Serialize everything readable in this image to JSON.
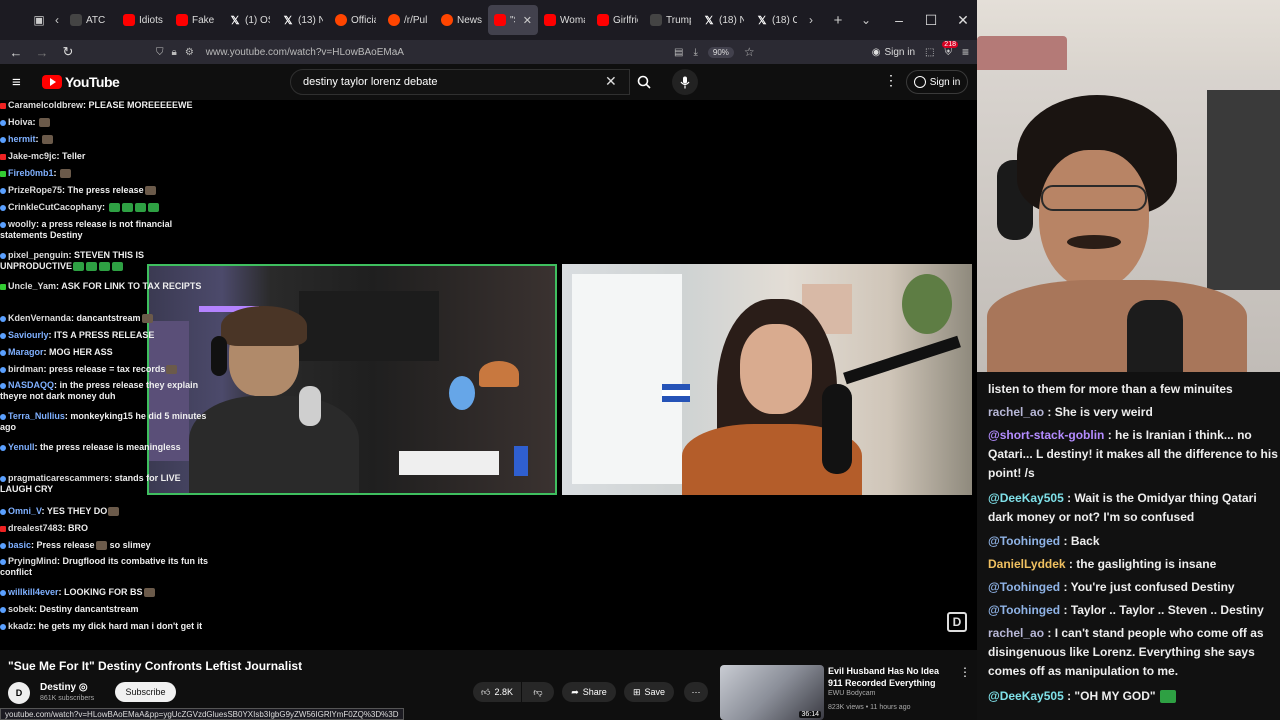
{
  "browser": {
    "tabs": [
      {
        "label": "ATC",
        "icon": "blank"
      },
      {
        "label": "Idiots",
        "icon": "yt"
      },
      {
        "label": "Fake L",
        "icon": "yt"
      },
      {
        "label": "(1) OS",
        "icon": "x"
      },
      {
        "label": "(13) N",
        "icon": "x"
      },
      {
        "label": "Officia",
        "icon": "rd"
      },
      {
        "label": "/r/Pul",
        "icon": "rd"
      },
      {
        "label": "News",
        "icon": "rd"
      },
      {
        "label": "\"Su",
        "icon": "yt",
        "active": true
      },
      {
        "label": "Woma",
        "icon": "yt"
      },
      {
        "label": "Girlfrie",
        "icon": "yt"
      },
      {
        "label": "Trump",
        "icon": "blank"
      },
      {
        "label": "(18) N",
        "icon": "x"
      },
      {
        "label": "(18) O",
        "icon": "x"
      }
    ],
    "url": "www.youtube.com/watch?v=HLowBAoEMaA",
    "zoom": "90%",
    "sign_in": "Sign in",
    "ext_count": "218",
    "status_url": "youtube.com/watch?v=HLowBAoEMaA&pp=ygUcZGVzdGluesSB0YXIsb3IgbG9yZW56IGRlYmF0ZQ%3D%3D"
  },
  "youtube": {
    "logo_text": "YouTube",
    "search_query": "destiny taylor lorenz debate",
    "sign_in": "Sign in",
    "video_title": "\"Sue Me For It\" Destiny Confronts Leftist Journalist",
    "channel_name": "Destiny ◎",
    "channel_subs": "861K subscribers",
    "subscribe": "Subscribe",
    "likes": "2.8K",
    "share": "Share",
    "save": "Save",
    "recommendation": {
      "title": "Evil Husband Has No Idea 911 Recorded Everything",
      "channel": "EWU Bodycam",
      "meta": "823K views • 11 hours ago",
      "duration": "36:14"
    }
  },
  "overlay_chat": [
    {
      "name": "Caramelcoldbrew",
      "text": "PLEASE MOREEEEEWE",
      "icon": "red"
    },
    {
      "name": "Hoiva",
      "text": "",
      "emote": true
    },
    {
      "name": "hermit",
      "text": "",
      "emote": true,
      "nameColor": "#7fb0ff"
    },
    {
      "name": "Jake-mc9jc",
      "text": "Teller",
      "icon": "red"
    },
    {
      "name": "Fireb0mb1",
      "text": "",
      "emote": true,
      "nameColor": "#7fb0ff",
      "icon": "green"
    },
    {
      "name": "PrizeRope75",
      "text": "The press release",
      "emote": true
    },
    {
      "name": "CrinkleCutCacophany",
      "text": "",
      "emote": "green"
    },
    {
      "name": "woolly",
      "text": "a press release is not financial statements Destiny"
    },
    {
      "name": "pixel_penguin",
      "text": "STEVEN THIS IS UNPRODUCTIVE",
      "emote": "green"
    },
    {
      "name": "Uncle_Yam",
      "text": "ASK FOR LINK TO TAX RECIPTS",
      "icon": "green"
    },
    {
      "name": "KdenVernanda",
      "text": "dancantstream",
      "emote": true
    },
    {
      "name": "Saviourly",
      "text": "ITS A PRESS RELEASE",
      "nameColor": "#7fb0ff"
    },
    {
      "name": "Maragor",
      "text": "MOG HER ASS",
      "nameColor": "#7fb0ff"
    },
    {
      "name": "birdman",
      "text": "press release = tax records",
      "emote": true
    },
    {
      "name": "NASDAQQ",
      "text": "in the press release they explain theyre not dark money duh",
      "nameColor": "#7fb0ff"
    },
    {
      "name": "Terra_Nullius",
      "text": "monkeyking15 he did 5 minutes ago",
      "nameColor": "#7fb0ff"
    },
    {
      "name": "Yenull",
      "text": "the press release is meaningless",
      "nameColor": "#7fb0ff"
    },
    {
      "name": "pragmaticarescammers",
      "text": "stands for LIVE LAUGH CRY"
    },
    {
      "name": "Omni_V",
      "text": "YES THEY DO",
      "emote": true,
      "nameColor": "#7fb0ff"
    },
    {
      "name": "drealest7483",
      "text": "BRO",
      "icon": "red"
    },
    {
      "name": "basic",
      "text": "Press release",
      "emote": true,
      "after": "so slimey",
      "nameColor": "#7fb0ff"
    },
    {
      "name": "PryingMind",
      "text": "Drugflood its combative its fun its conflict"
    },
    {
      "name": "willkill4ever",
      "text": "LOOKING FOR BS",
      "emote": true,
      "nameColor": "#7fb0ff"
    },
    {
      "name": "sobek",
      "text": "Destiny dancantstream"
    },
    {
      "name": "kkadz",
      "text": "he gets my dick hard man i don't get it"
    }
  ],
  "side_chat": [
    {
      "name": "",
      "text": "listen to them for more than a few minuites",
      "color": "#eee"
    },
    {
      "name": "rachel_ao",
      "text": "She is very weird",
      "color": "#b7b7d6",
      "sep": " : "
    },
    {
      "name": "@short-stack-goblin",
      "text": "he is Iranian i think... no Qatari... L destiny! it makes all the difference to his point! /s",
      "color": "#b48cff",
      "sep": " : "
    },
    {
      "name": "@DeeKay505",
      "text": "Wait is the Omidyar thing Qatari dark money or not? I'm so confused",
      "color": "#7fe0e8",
      "sep": " : "
    },
    {
      "name": "@Toohinged",
      "text": "Back",
      "color": "#8fb3e6",
      "sep": " : "
    },
    {
      "name": "DanielLyddek",
      "text": "the gaslighting is insane",
      "color": "#f0c060",
      "sep": " : "
    },
    {
      "name": "@Toohinged",
      "text": "You're just confused Destiny",
      "color": "#8fb3e6",
      "sep": " : "
    },
    {
      "name": "@Toohinged",
      "text": "Taylor .. Taylor .. Steven .. Destiny",
      "color": "#8fb3e6",
      "sep": " : "
    },
    {
      "name": "rachel_ao",
      "text": "I can't stand people who come off as disingenuous like Lorenz. Everything she says comes off as manipulation to me.",
      "color": "#b7b7d6",
      "sep": " : "
    },
    {
      "name": "@DeeKay505",
      "text": "\"OH MY GOD\"",
      "color": "#7fe0e8",
      "sep": " : ",
      "emote": true
    }
  ]
}
